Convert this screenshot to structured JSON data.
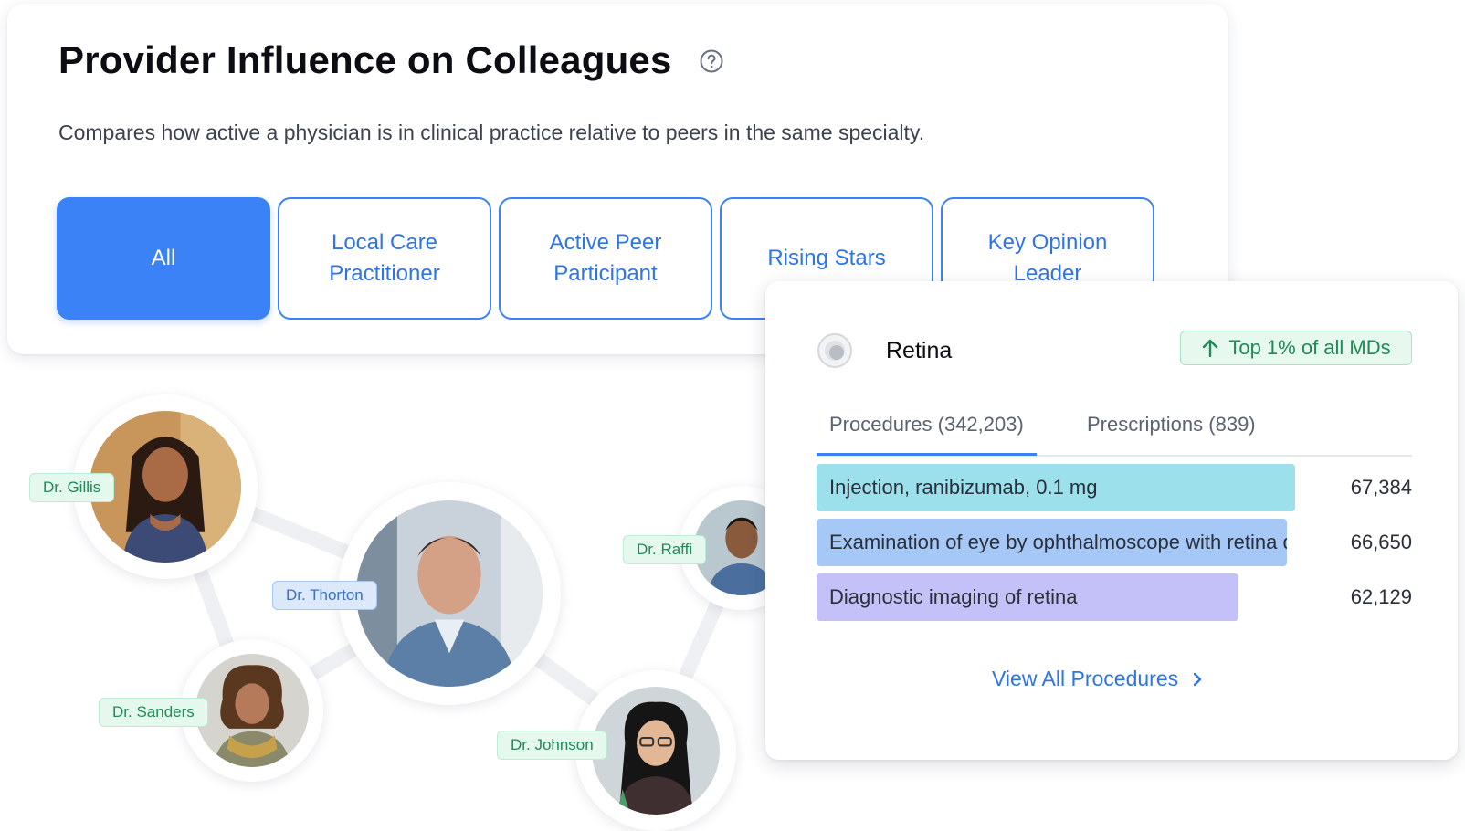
{
  "header": {
    "title": "Provider Influence on Colleagues",
    "subtitle": "Compares how active a physician is in clinical practice relative to peers in the same specialty."
  },
  "filters": [
    {
      "label": "All",
      "active": true
    },
    {
      "label": "Local Care Practitioner",
      "active": false
    },
    {
      "label": "Active Peer Participant",
      "active": false
    },
    {
      "label": "Rising Stars",
      "active": false
    },
    {
      "label": "Key Opinion Leader",
      "active": false
    }
  ],
  "network": {
    "doctors": [
      {
        "name": "Dr. Gillis",
        "tag_color": "green"
      },
      {
        "name": "Dr. Thorton",
        "tag_color": "blue"
      },
      {
        "name": "Dr. Raffi",
        "tag_color": "green"
      },
      {
        "name": "Dr. Sanders",
        "tag_color": "green"
      },
      {
        "name": "Dr. Johnson",
        "tag_color": "green"
      }
    ]
  },
  "detail": {
    "specialty": "Retina",
    "specialty_icon": "eye-icon",
    "rank_badge": "Top 1% of all MDs",
    "rank_icon": "arrow-up-icon",
    "tabs": [
      {
        "label": "Procedures (342,203)",
        "active": true
      },
      {
        "label": "Prescriptions (839)",
        "active": false
      }
    ],
    "procedures": [
      {
        "label": "Injection, ranibizumab, 0.1 mg",
        "value": "67,384",
        "count": 67384,
        "color": "#9be0eb"
      },
      {
        "label": "Examination of eye by ophthalmoscope with retina drawing",
        "value": "66,650",
        "count": 66650,
        "color": "#a6c8f7"
      },
      {
        "label": "Diagnostic imaging of retina",
        "value": "62,129",
        "count": 62129,
        "color": "#c3c1f7"
      }
    ],
    "view_all_label": "View All Procedures",
    "view_all_icon": "chevron-right-icon"
  }
}
